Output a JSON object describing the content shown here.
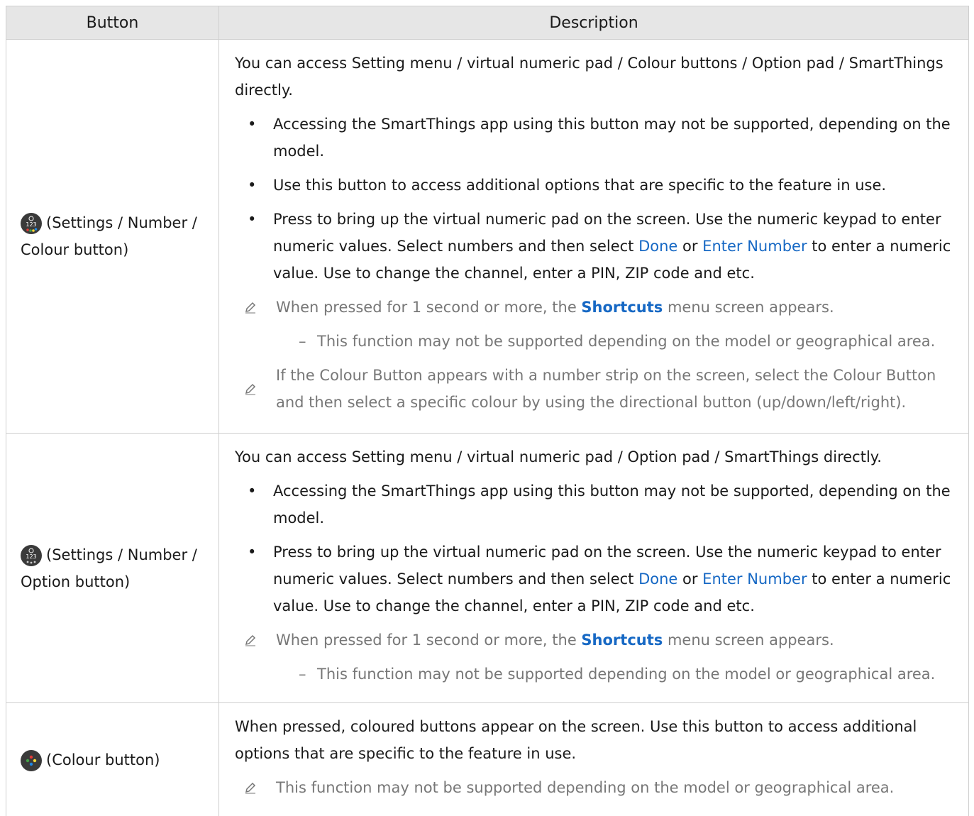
{
  "table": {
    "headers": [
      "Button",
      "Description"
    ],
    "rows": [
      {
        "button_label": "(Settings / Number / Colour button)",
        "icon": "settings-number-colour-icon",
        "intro": "You can access Setting menu / virtual numeric pad / Colour buttons / Option pad / SmartThings directly.",
        "bullets": [
          "Accessing the SmartThings app using this button may not be supported, depending on the model.",
          "Use this button to access additional options that are specific to the feature in use.",
          {
            "pre": "Press to bring up the virtual numeric pad on the screen. Use the numeric keypad to enter numeric values. Select numbers and then select ",
            "link1": "Done",
            "mid": " or ",
            "link2": "Enter Number",
            "post": " to enter a numeric value. Use to change the channel, enter a PIN, ZIP code and etc."
          }
        ],
        "note1": {
          "pre": "When pressed for 1 second or more, the ",
          "link": "Shortcuts",
          "post": " menu screen appears."
        },
        "sub1": "This function may not be supported depending on the model or geographical area.",
        "note2": "If the Colour Button appears with a number strip on the screen, select the Colour Button and then select a specific colour by using the directional button (up/down/left/right)."
      },
      {
        "button_label": "(Settings / Number / Option button)",
        "icon": "settings-number-option-icon",
        "intro": "You can access Setting menu / virtual numeric pad / Option pad / SmartThings directly.",
        "bullets": [
          "Accessing the SmartThings app using this button may not be supported, depending on the model.",
          {
            "pre": "Press to bring up the virtual numeric pad on the screen. Use the numeric keypad to enter numeric values. Select numbers and then select ",
            "link1": "Done",
            "mid": " or ",
            "link2": "Enter Number",
            "post": " to enter a numeric value. Use to change the channel, enter a PIN, ZIP code and etc."
          }
        ],
        "note1": {
          "pre": "When pressed for 1 second or more, the ",
          "link": "Shortcuts",
          "post": " menu screen appears."
        },
        "sub1": "This function may not be supported depending on the model or geographical area."
      },
      {
        "button_label": "(Colour button)",
        "icon": "colour-button-icon",
        "intro": "When pressed, coloured buttons appear on the screen. Use this button to access additional options that are specific to the feature in use.",
        "note1": "This function may not be supported depending on the model or geographical area."
      }
    ]
  },
  "colors": {
    "header_bg": "#e6e6e6",
    "link": "#1668c4",
    "note_text": "#777777",
    "border": "#cfcfcf"
  }
}
